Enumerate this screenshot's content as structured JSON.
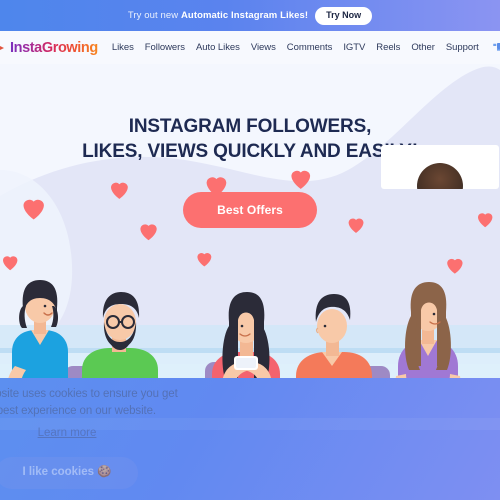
{
  "promo": {
    "text_prefix": "Try out new ",
    "text_strong": "Automatic Instagram Likes!",
    "button_label": "Try Now",
    "gradient_start": "#4E86EC",
    "gradient_end": "#8B94F2"
  },
  "nav": {
    "logo_text": "InstaGrowing",
    "logo_icon": "arrow-right-icon",
    "cart_icon": "shopping-cart-icon",
    "links": [
      {
        "label": "Likes"
      },
      {
        "label": "Followers"
      },
      {
        "label": "Auto Likes"
      },
      {
        "label": "Views"
      },
      {
        "label": "Comments"
      },
      {
        "label": "IGTV"
      },
      {
        "label": "Reels"
      },
      {
        "label": "Other"
      },
      {
        "label": "Support"
      }
    ]
  },
  "hero": {
    "headline_line1": "INSTAGRAM FOLLOWERS,",
    "headline_line2": "LIKES, VIEWS QUICKLY AND EASILY!",
    "cta_label": "Best Offers",
    "cta_color": "#FC7070",
    "headline_color": "#1E2A52",
    "background_color": "#F4F7FE",
    "blob_color": "#E4E7F8"
  },
  "illustration": {
    "alt": "people-at-desk-with-phones-illustration",
    "heart_color": "#FC7070",
    "desk_color": "#C8E4F7",
    "people": [
      {
        "name": "woman-blue-shirt-standing-with-phone",
        "shirt_color": "#1CA2E0",
        "hair_color": "#2B2B38"
      },
      {
        "name": "bearded-man-green-shirt-at-laptop",
        "shirt_color": "#5BC953",
        "hair_color": "#2B2B38"
      },
      {
        "name": "woman-pink-shirt-with-phone",
        "shirt_color": "#F4636E",
        "hair_color": "#2B2B38"
      },
      {
        "name": "man-orange-shirt-with-cup",
        "shirt_color": "#F47A5A",
        "hair_color": "#2B2B38"
      },
      {
        "name": "woman-purple-shirt-standing-with-phone",
        "shirt_color": "#A078D4",
        "hair_color": "#8C6449"
      }
    ]
  },
  "cookie_consent": {
    "message": "This website uses cookies to ensure you get the best experience on our website.",
    "learn_more_label": "Learn more",
    "accept_label": "I like cookies 🍪"
  },
  "bottom": {
    "background_gradient_start": "#5C8FF0",
    "background_gradient_end": "#7E8FF2",
    "review_card": {
      "name": "testimonial-card",
      "avatar": "person-avatar-photo"
    }
  }
}
